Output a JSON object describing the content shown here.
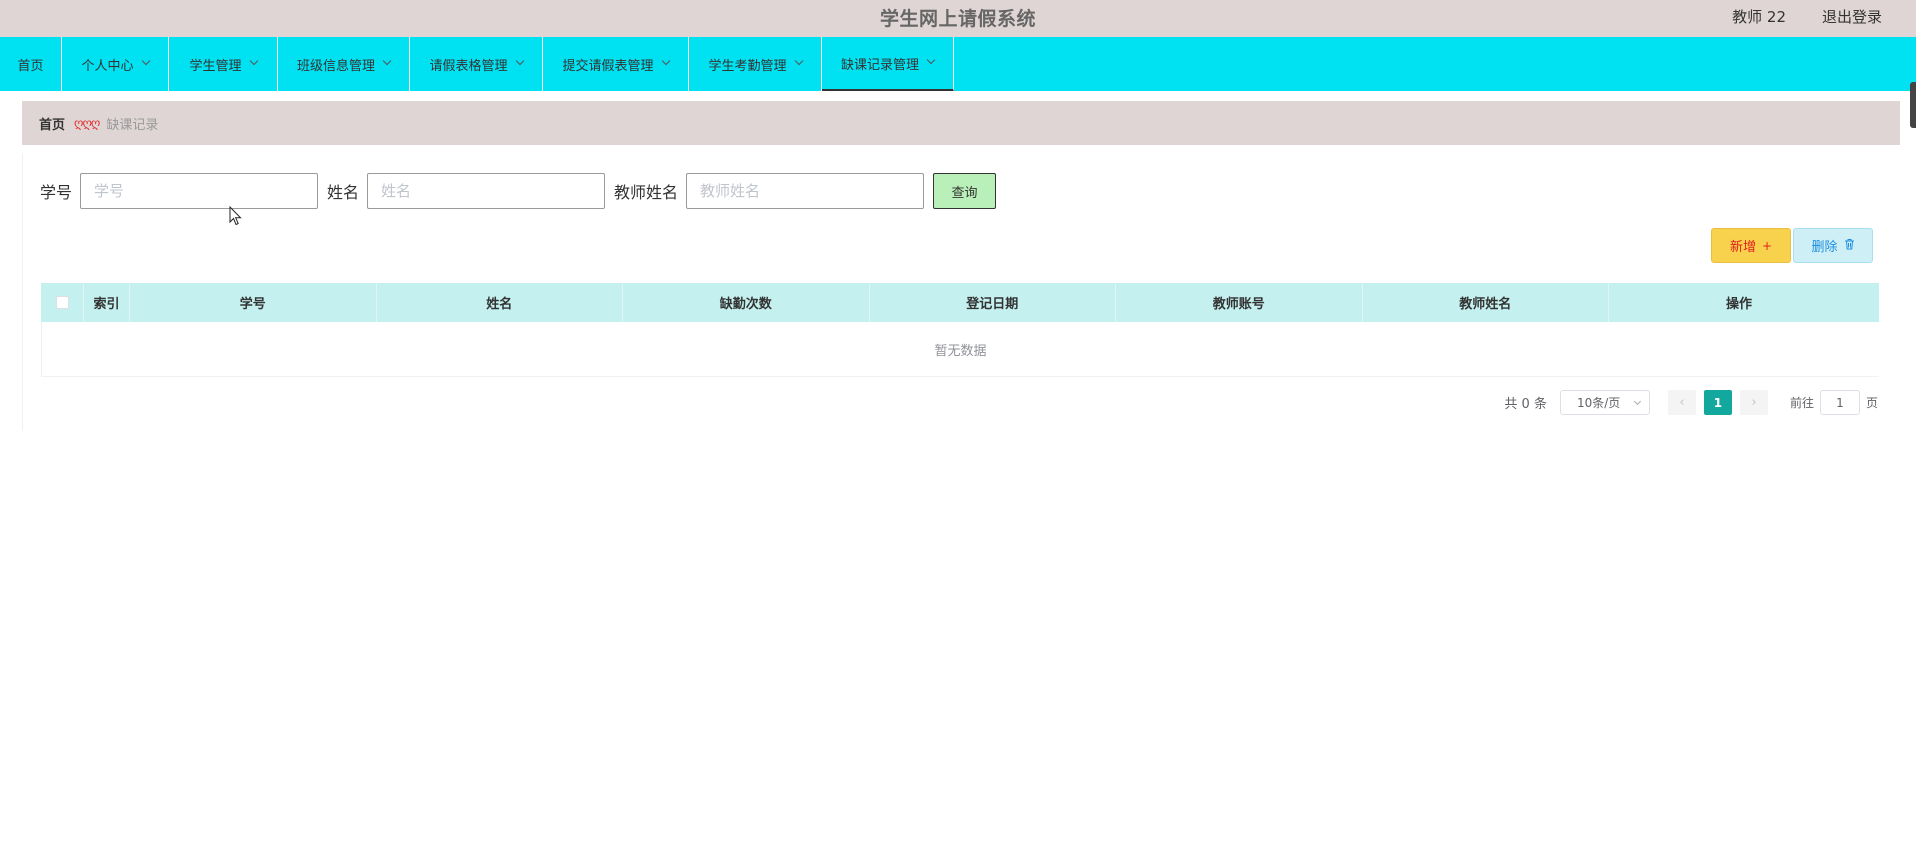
{
  "header": {
    "title": "学生网上请假系统",
    "user": "教师 22",
    "logout": "退出登录"
  },
  "nav": {
    "items": [
      {
        "label": "首页",
        "dropdown": false
      },
      {
        "label": "个人中心",
        "dropdown": true
      },
      {
        "label": "学生管理",
        "dropdown": true
      },
      {
        "label": "班级信息管理",
        "dropdown": true
      },
      {
        "label": "请假表格管理",
        "dropdown": true
      },
      {
        "label": "提交请假表管理",
        "dropdown": true
      },
      {
        "label": "学生考勤管理",
        "dropdown": true
      },
      {
        "label": "缺课记录管理",
        "dropdown": true,
        "active": true
      }
    ]
  },
  "breadcrumb": {
    "home": "首页",
    "separator": "ღღღ",
    "current": "缺课记录"
  },
  "search": {
    "fields": [
      {
        "label": "学号",
        "placeholder": "学号",
        "value": ""
      },
      {
        "label": "姓名",
        "placeholder": "姓名",
        "value": ""
      },
      {
        "label": "教师姓名",
        "placeholder": "教师姓名",
        "value": ""
      }
    ],
    "query_button": "查询"
  },
  "actions": {
    "add": "新增",
    "add_icon": "+",
    "delete": "删除",
    "delete_icon": "🗑"
  },
  "table": {
    "columns": [
      "索引",
      "学号",
      "姓名",
      "缺勤次数",
      "登记日期",
      "教师账号",
      "教师姓名",
      "操作"
    ],
    "rows": [],
    "empty_text": "暂无数据"
  },
  "pagination": {
    "total": "共 0 条",
    "page_size": "10条/页",
    "prev_icon": "‹",
    "current_page": "1",
    "next_icon": "›",
    "goto_label": "前往",
    "goto_value": "1",
    "page_suffix": "页"
  },
  "colors": {
    "nav_bg": "#00e1f2",
    "header_bg": "#e0d5d5",
    "table_header_bg": "#c4f0ef",
    "query_button_bg": "#b9f0b9",
    "add_button_bg": "#f8d24c",
    "delete_button_bg": "#cdeff5",
    "active_page_bg": "#13a89e"
  }
}
